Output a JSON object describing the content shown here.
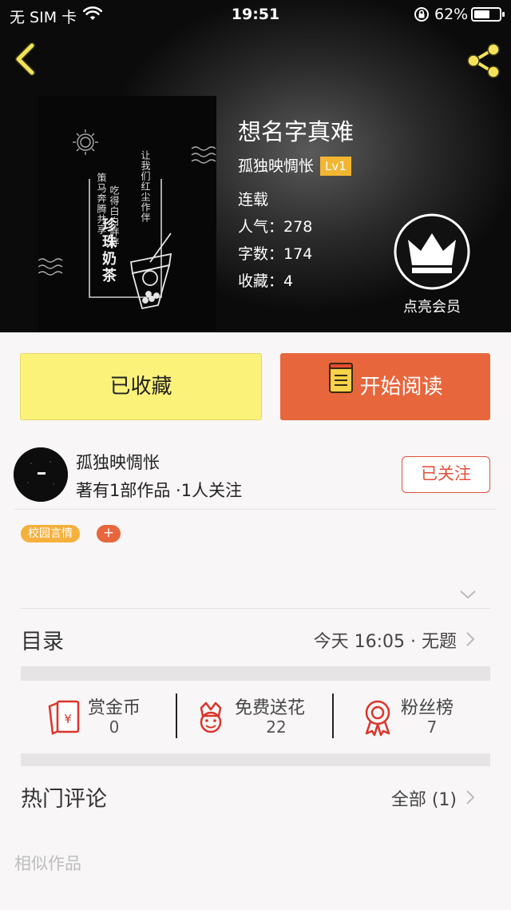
{
  "status_bar": {
    "carrier": "无 SIM 卡",
    "time": "19:51",
    "battery_percent": "62%",
    "battery_level": 0.62
  },
  "book": {
    "title": "想名字真难",
    "author": "孤独映惆怅",
    "level": "Lv1",
    "status": "连载",
    "popularity_label": "人气：",
    "popularity": "278",
    "word_count_label": "字数：",
    "word_count": "174",
    "favorites_label": "收藏：",
    "favorites": "4"
  },
  "cover": {
    "title": "珍珠奶茶",
    "poem_line_1": "让我们红尘作伴",
    "poem_line_2": "吃得白白胖胖",
    "poem_line_3": "策马奔腾共享"
  },
  "vip": {
    "label": "点亮会员"
  },
  "actions": {
    "favorited_label": "已收藏",
    "read_label": "开始阅读"
  },
  "author_card": {
    "name": "孤独映惆怅",
    "stats": "著有1部作品 ·1人关注",
    "follow_label": "已关注"
  },
  "tags": [
    {
      "label": "校园言情"
    }
  ],
  "tag_add_label": "+",
  "toc": {
    "title": "目录",
    "latest": "今天 16:05 · 无题"
  },
  "stats": [
    {
      "label": "赏金币",
      "value": "0",
      "icon": "red-envelope-icon"
    },
    {
      "label": "免费送花",
      "value": "22",
      "icon": "flower-icon"
    },
    {
      "label": "粉丝榜",
      "value": "7",
      "icon": "ribbon-medal-icon"
    }
  ],
  "comments": {
    "title": "热门评论",
    "all_label": "全部 (1)"
  },
  "similar": {
    "title": "相似作品"
  },
  "colors": {
    "accent_orange": "#e8663c",
    "favorite_yellow": "#fbf27a",
    "level_badge": "#f2b632",
    "icon_yellow": "#f5e15a",
    "stat_red": "#d9352b"
  }
}
